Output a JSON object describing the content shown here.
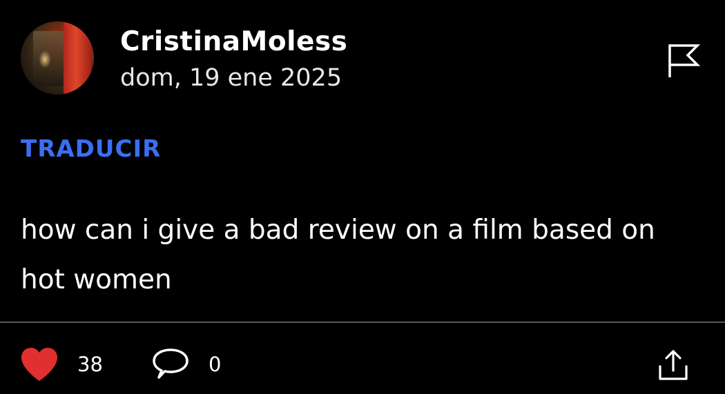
{
  "post": {
    "author": "CristinaMoless",
    "date": "dom, 19 ene 2025",
    "translate_label": "TRADUCIR",
    "text": "how can i give a bad review on a film based on hot women"
  },
  "actions": {
    "likes": "38",
    "comments": "0"
  },
  "icons": {
    "flag": "flag-icon",
    "like": "heart-icon",
    "comment": "comment-bubble-icon",
    "share": "share-icon"
  },
  "colors": {
    "background": "#000000",
    "text": "#ffffff",
    "translate": "#3b6ff2",
    "heart": "#e0302f",
    "divider": "#5a5a5a"
  }
}
